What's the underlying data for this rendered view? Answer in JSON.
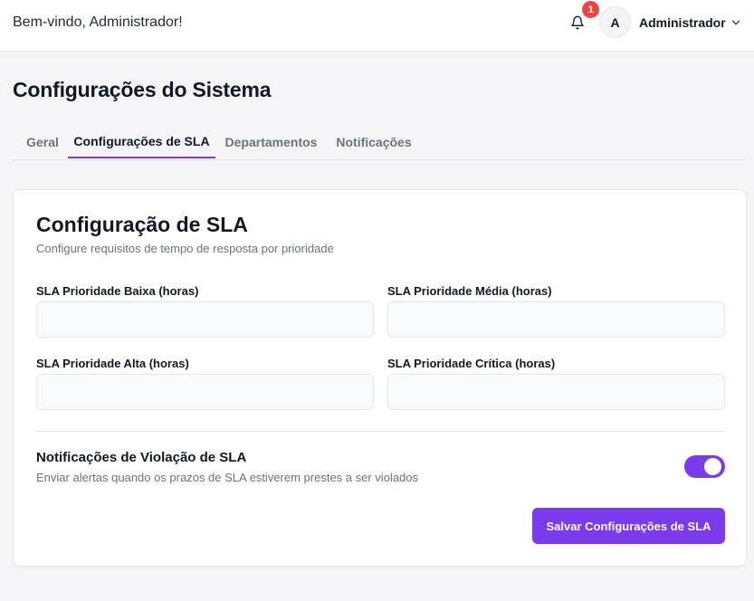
{
  "header": {
    "welcome": "Bem-vindo, Administrador!",
    "notification_count": "1",
    "avatar_initial": "A",
    "user_name": "Administrador"
  },
  "page": {
    "title": "Configurações do Sistema"
  },
  "tabs": [
    {
      "label": "Geral",
      "active": false
    },
    {
      "label": "Configurações de SLA",
      "active": true
    },
    {
      "label": "Departamentos",
      "active": false
    },
    {
      "label": "Notificações",
      "active": false
    }
  ],
  "sla": {
    "title": "Configuração de SLA",
    "subtitle": "Configure requisitos de tempo de resposta por prioridade",
    "fields": [
      {
        "label": "SLA Prioridade Baixa (horas)",
        "value": ""
      },
      {
        "label": "SLA Prioridade Média (horas)",
        "value": ""
      },
      {
        "label": "SLA Prioridade Alta (horas)",
        "value": ""
      },
      {
        "label": "SLA Prioridade Crítica (horas)",
        "value": ""
      }
    ],
    "notifications": {
      "title": "Notificações de Violação de SLA",
      "description": "Enviar alertas quando os prazos de SLA estiverem prestes a ser violados",
      "enabled": true
    },
    "save_label": "Salvar Configurações de SLA"
  },
  "colors": {
    "accent": "#7c3aed",
    "badge": "#ef4444"
  },
  "icons": {
    "bell": "bell-icon",
    "chevron": "chevron-down-icon"
  }
}
